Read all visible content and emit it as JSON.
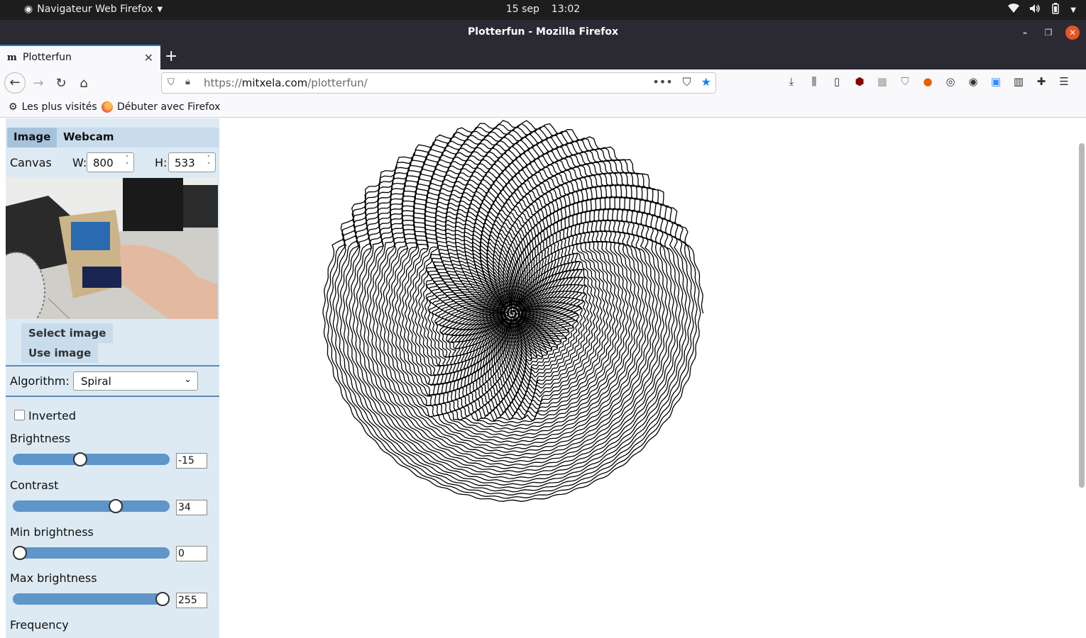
{
  "system": {
    "app_menu": "Navigateur Web Firefox",
    "date": "15 sep",
    "time": "13:02"
  },
  "window": {
    "title": "Plotterfun - Mozilla Firefox"
  },
  "browser": {
    "tab": {
      "favicon": "m",
      "label": "Plotterfun"
    },
    "url_prefix": "https://",
    "url_domain": "mitxela.com",
    "url_path": "/plotterfun/",
    "bookmarks": [
      "Les plus visités",
      "Débuter avec Firefox"
    ]
  },
  "app": {
    "tabs": [
      "Image",
      "Webcam"
    ],
    "canvas": {
      "label": "Canvas",
      "w_label": "W:",
      "w_value": "800",
      "h_label": "H:",
      "h_value": "533"
    },
    "buttons": {
      "select_image": "Select image",
      "use_image": "Use image"
    },
    "algorithm": {
      "label": "Algorithm:",
      "value": "Spiral"
    },
    "inverted": {
      "label": "Inverted",
      "checked": false
    },
    "sliders": [
      {
        "label": "Brightness",
        "value": "-15",
        "min": -100,
        "max": 100
      },
      {
        "label": "Contrast",
        "value": "34",
        "min": -100,
        "max": 100
      },
      {
        "label": "Min brightness",
        "value": "0",
        "min": 0,
        "max": 255
      },
      {
        "label": "Max brightness",
        "value": "255",
        "min": 0,
        "max": 255
      }
    ],
    "next_label": "Frequency"
  },
  "icons": {
    "ubuntu": "ubuntu-logo-icon",
    "wifi": "wifi-icon",
    "volume": "volume-icon",
    "battery": "battery-icon",
    "back": "back-arrow-icon",
    "forward": "forward-arrow-icon",
    "reload": "reload-icon",
    "home": "home-icon"
  },
  "colors": {
    "sidebar_bg": "#ddeaf4",
    "slider_track": "#5f95c8",
    "accent_blue": "#0a84ff",
    "close_orange": "#e95420"
  }
}
